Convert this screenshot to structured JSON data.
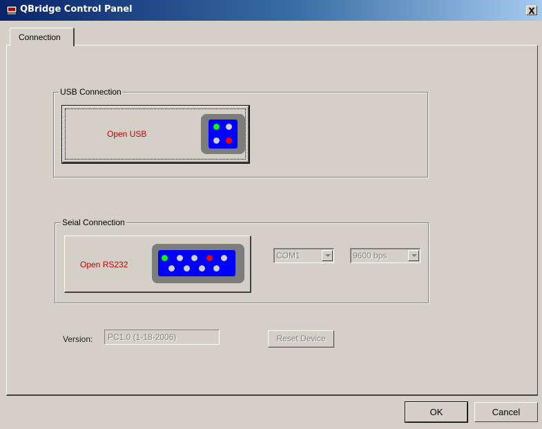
{
  "window": {
    "title": "QBridge Control Panel",
    "close_label": "X"
  },
  "tabs": [
    {
      "label": "Connection",
      "active": true
    }
  ],
  "usb": {
    "group_label": "USB Connection",
    "button_label": "Open USB",
    "icon": "usb-connector-icon"
  },
  "serial": {
    "group_label": "Seial Connection",
    "button_label": "Open RS232",
    "icon": "rs232-connector-icon",
    "port": {
      "value": "COM1",
      "enabled": false
    },
    "baud": {
      "value": "9600 bps",
      "enabled": false
    }
  },
  "version": {
    "label": "Version:",
    "value": "PC1.0 (1-18-2006)"
  },
  "reset_button": {
    "label": "Reset Device",
    "enabled": false
  },
  "footer": {
    "ok_label": "OK",
    "cancel_label": "Cancel"
  },
  "colors": {
    "titlebar_start": "#0a246a",
    "titlebar_end": "#a6caf0",
    "dialog_bg": "#d4d0c8",
    "button_text_red": "#c00000",
    "connector_body": "#0000ff",
    "connector_frame": "#7d7d7d",
    "pin_green": "#00ff00",
    "pin_red": "#ff0000",
    "pin_grey": "#d0d0d0"
  }
}
